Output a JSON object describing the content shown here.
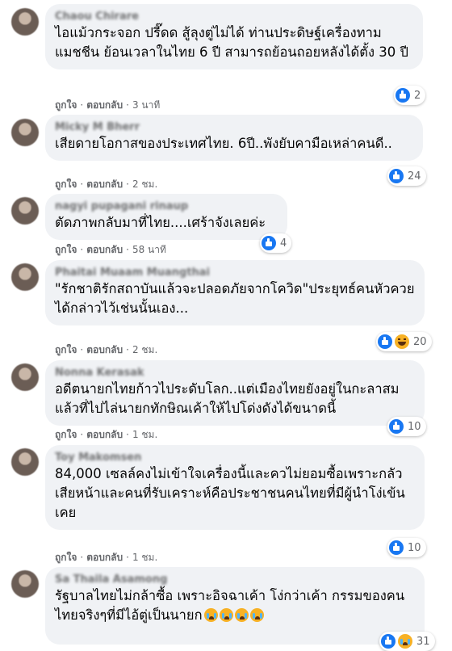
{
  "labels": {
    "like": "ถูกใจ",
    "reply": "ตอบกลับ",
    "separator": "·"
  },
  "comments": [
    {
      "author": "Chaou Chirare",
      "text": "ไอแม้วกระจอก ปรี๊ดด สู้ลุงตู่ไม่ได้ ท่านประดิษฐ์เครื่องทามแมชชีน ย้อนเวลาในไทย 6 ปี สามารถย้อนถอยหลังได้ตั้ง 30 ปี",
      "time": "3 นาที",
      "reactions": [
        "like"
      ],
      "count": "2"
    },
    {
      "author": "Micky M Bherr",
      "text": "เสียดายโอกาสของประเทศไทย. 6ปี..พังยับคามือเหล่าคนดี..",
      "time": "2 ชม.",
      "reactions": [
        "like"
      ],
      "count": "24"
    },
    {
      "author": "nagyi pupagani rinaup",
      "text": "ตัดภาพกลับมาที่ไทย....เศร้าจังเลยค่ะ",
      "time": "58 นาที",
      "reactions": [
        "like"
      ],
      "count": "4"
    },
    {
      "author": "Phaitai Muaam Muangthai",
      "text": "\"รักชาติรักสถาบันแล้วจะปลอดภัยจากโควิด\"ประยุทธ์คนหัวควยได้กล่าวไว้เช่นนั้นเอง...",
      "time": "2 ชม.",
      "reactions": [
        "like",
        "haha"
      ],
      "count": "20"
    },
    {
      "author": "Nonna Kerasak",
      "text": "อดีตนายกไทยก้าวไประดับโลก..แต่เมืองไทยยังอยู่ในกะลาสมแล้วที่ไปไล่นายกทักษิณเค้าให้ไปโด่งดังได้ขนาดนี้",
      "time": "1 ชม.",
      "reactions": [
        "like"
      ],
      "count": "10"
    },
    {
      "author": "Toy Makomsen",
      "text": "84,000 เซลล์คงไม่เข้าใจเครื่องนี้และควไม่ยอมซื้อเพราะกลัวเสียหน้าและคนที่รับเคราะห์คือประชาชนคนไทยที่มีผู้นำโง่เข้นเคย",
      "time": "1 ชม.",
      "reactions": [
        "like"
      ],
      "count": "10"
    },
    {
      "author": "Sa Thaila Asamong",
      "text": "รัฐบาลไทยไม่กล้าซื้อ เพราะอิจฉาเค้า โง่กว่าเค้า กรรมของคนไทยจริงๆที่มีไอ้ตู่เป็นนายก",
      "emoji_count": "4 cry",
      "time": "",
      "reactions": [
        "like",
        "cry"
      ],
      "count": "31"
    }
  ]
}
